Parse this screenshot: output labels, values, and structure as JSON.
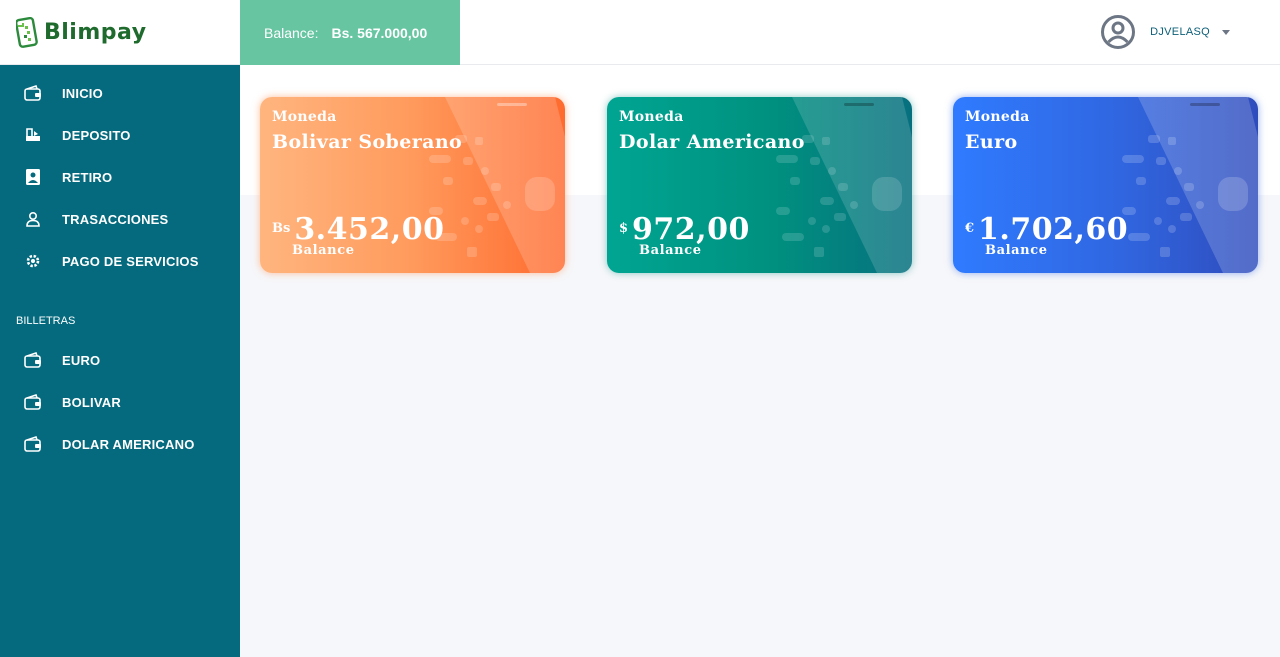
{
  "brand": {
    "name": "Blimpay"
  },
  "header": {
    "balance_label": "Balance:",
    "balance_value": "Bs. 567.000,00",
    "username": "DJVELASQ"
  },
  "sidebar": {
    "items": [
      {
        "label": "INICIO",
        "icon": "wallet-icon"
      },
      {
        "label": "DEPOSITO",
        "icon": "deposit-icon"
      },
      {
        "label": "RETIRO",
        "icon": "withdraw-icon"
      },
      {
        "label": "TRASACCIONES",
        "icon": "user-icon"
      },
      {
        "label": "PAGO DE SERVICIOS",
        "icon": "gear-icon"
      }
    ],
    "section_title": "BILLETRAS",
    "wallets": [
      {
        "label": "EURO",
        "icon": "wallet-icon"
      },
      {
        "label": "BOLIVAR",
        "icon": "wallet-icon"
      },
      {
        "label": "DOLAR AMERICANO",
        "icon": "wallet-icon"
      }
    ]
  },
  "cards": [
    {
      "caption": "Moneda",
      "currency": "Bolivar Soberano",
      "symbol": "Bs",
      "amount": "3.452,00",
      "balance_label": "Balance",
      "color": "#ff8a4c"
    },
    {
      "caption": "Moneda",
      "currency": "Dolar Americano",
      "symbol": "$",
      "amount": "972,00",
      "balance_label": "Balance",
      "color": "#00a592"
    },
    {
      "caption": "Moneda",
      "currency": "Euro",
      "symbol": "€",
      "amount": "1.702,60",
      "balance_label": "Balance",
      "color": "#2f7bff"
    }
  ],
  "colors": {
    "sidebar": "#056a7e",
    "balance_box": "#67c5a2",
    "brand_green": "#1f6b2e"
  }
}
